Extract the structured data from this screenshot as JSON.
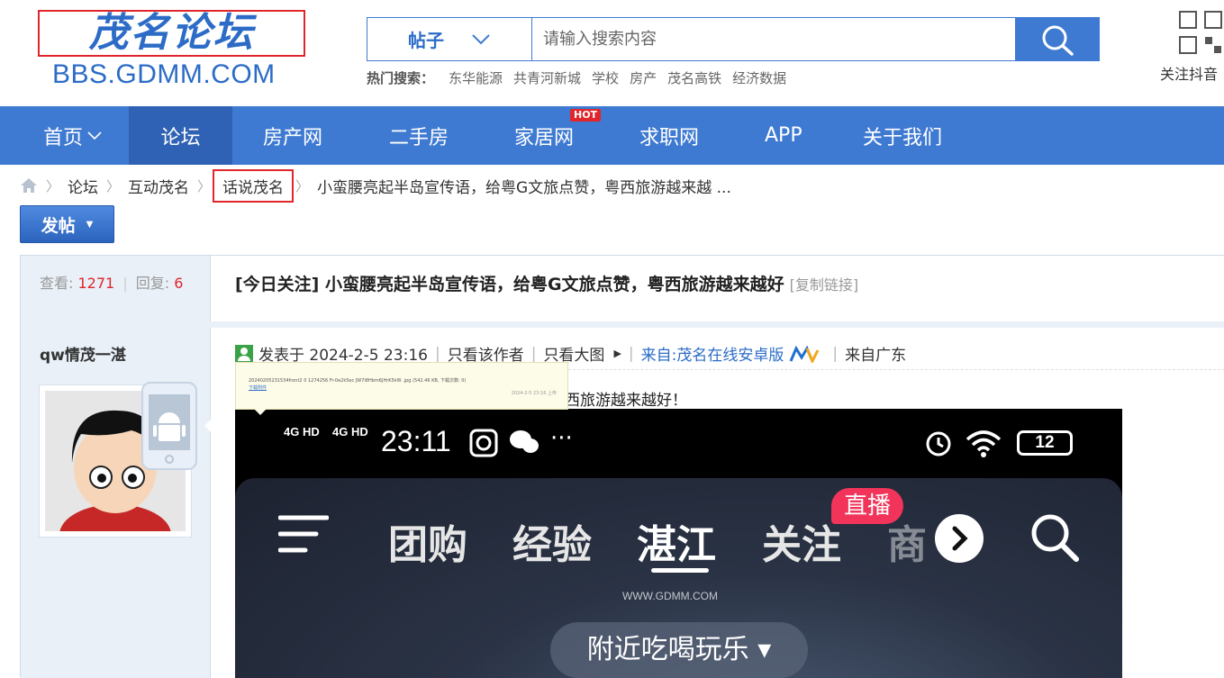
{
  "header": {
    "logo_cn": "茂名论坛",
    "logo_en": "BBS.GDMM.COM",
    "search": {
      "type_label": "帖子",
      "placeholder": "请输入搜索内容"
    },
    "hot_search": {
      "label": "热门搜索：",
      "items": [
        "东华能源",
        "共青河新城",
        "学校",
        "房产",
        "茂名高铁",
        "经济数据"
      ]
    },
    "douyin_label": "关注抖音"
  },
  "nav": {
    "items": [
      "首页",
      "论坛",
      "房产网",
      "二手房",
      "家居网",
      "求职网",
      "APP",
      "关于我们"
    ],
    "hot_badge": "HOT",
    "active": "论坛"
  },
  "breadcrumb": {
    "items": [
      "论坛",
      "互动茂名",
      "话说茂名",
      "小蛮腰亮起半岛宣传语，给粤G文旅点赞，粤西旅游越来越 ..."
    ]
  },
  "post_button": "发帖",
  "thread": {
    "stats": {
      "views_label": "查看:",
      "views": "1271",
      "replies_label": "回复:",
      "replies": "6"
    },
    "title": "[今日关注] 小蛮腰亮起半岛宣传语，给粤G文旅点赞，粤西旅游越来越好",
    "copy_link": "[复制链接]",
    "author": "qw情茂一湛",
    "meta": {
      "posted": "发表于 2024-2-5 23:16",
      "only_author": "只看该作者",
      "only_images": "只看大图",
      "source": "来自:茂名在线安卓版",
      "location": "来自广东"
    },
    "attachment": {
      "filename": "20240205231534front2  0  1274256  Fr-0e2k5ec  JW7i8Hbm6JHrK5kW .jpg",
      "size_info": "(542.46 KB, 下载次数: 0)",
      "download": "下载附件",
      "time": "2024-2-5 23:16 上传"
    },
    "body_text": "西旅游越来越好！"
  },
  "phone_screenshot": {
    "signal1": "4G HD",
    "signal2": "4G HD",
    "clock": "23:11",
    "battery": "12",
    "tabs": [
      "团购",
      "经验",
      "湛江",
      "关注",
      "商"
    ],
    "live_badge": "直播",
    "nearby": "附近吃喝玩乐",
    "watermark": "WWW.GDMM.COM"
  }
}
